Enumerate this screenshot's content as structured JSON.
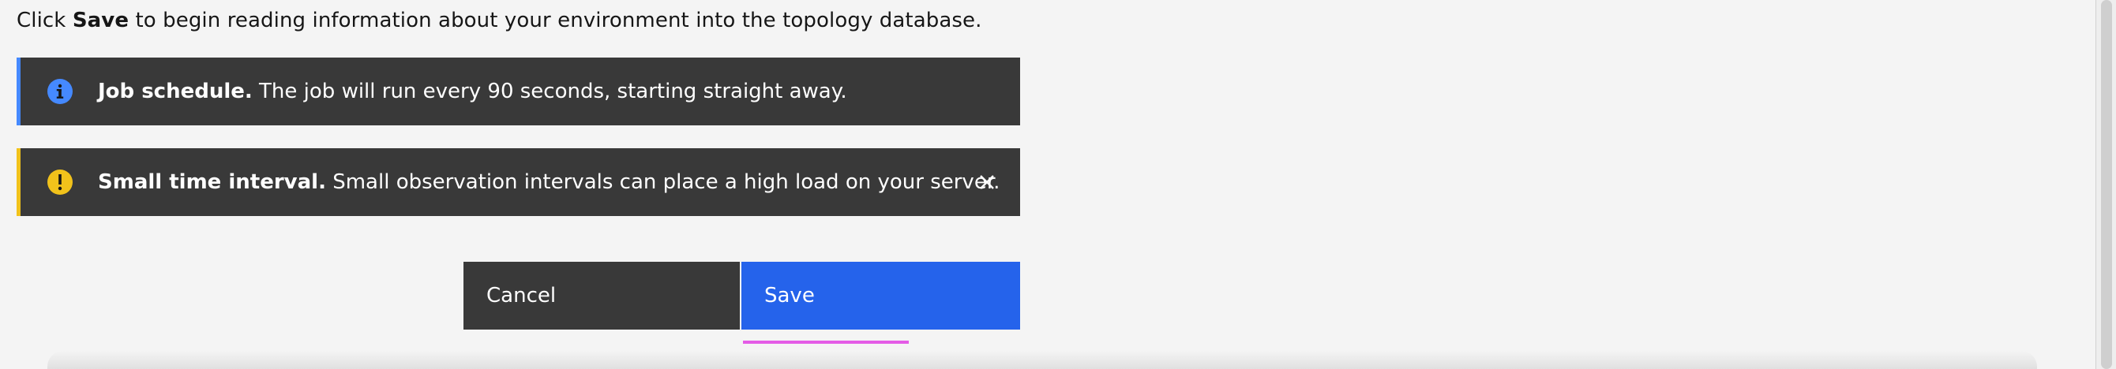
{
  "intro": {
    "prefix": "Click ",
    "bold": "Save",
    "suffix": " to begin reading information about your environment into the topology database."
  },
  "notifications": [
    {
      "kind": "info",
      "icon": "info-icon",
      "accent_color": "#4589ff",
      "title": "Job schedule.",
      "message": " The job will run every 90 seconds, starting straight away."
    },
    {
      "kind": "warning",
      "icon": "warning-icon",
      "accent_color": "#f1c21b",
      "title": "Small time interval.",
      "message": " Small observation intervals can place a high load on your server.",
      "close_icon": "close-icon"
    }
  ],
  "actions": {
    "cancel_label": "Cancel",
    "save_label": "Save",
    "save_color": "#2563eb",
    "cancel_color": "#393939"
  }
}
